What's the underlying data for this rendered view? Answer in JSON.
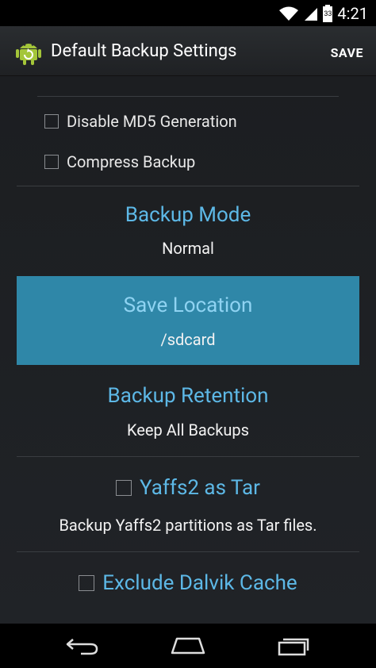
{
  "status_bar": {
    "time": "4:21",
    "battery_level": "33"
  },
  "action_bar": {
    "title": "Default Backup Settings",
    "save_label": "SAVE"
  },
  "options": {
    "disable_md5_label": "Disable MD5 Generation",
    "compress_backup_label": "Compress Backup"
  },
  "settings": {
    "backup_mode": {
      "title": "Backup Mode",
      "value": "Normal"
    },
    "save_location": {
      "title": "Save Location",
      "value": "/sdcard"
    },
    "backup_retention": {
      "title": "Backup Retention",
      "value": "Keep All Backups"
    },
    "yaffs2": {
      "title": "Yaffs2 as Tar",
      "description": "Backup Yaffs2 partitions as Tar files."
    },
    "dalvik": {
      "title": "Exclude Dalvik Cache"
    }
  },
  "colors": {
    "accent_blue": "#5db8e6",
    "selected_bg": "#2f87a8",
    "android_green": "#a4c639"
  },
  "icons": {
    "wifi": "wifi-icon",
    "signal": "signal-icon",
    "battery": "battery-icon",
    "app": "android-backup-icon",
    "back": "back-icon",
    "home": "home-icon",
    "recents": "recents-icon"
  }
}
